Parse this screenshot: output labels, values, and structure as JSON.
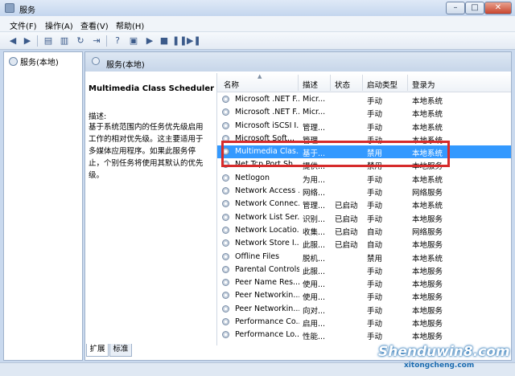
{
  "window": {
    "title": "服务",
    "min": "–",
    "max": "□",
    "close": "✕"
  },
  "menu": [
    "文件(F)",
    "操作(A)",
    "查看(V)",
    "帮助(H)"
  ],
  "tree": {
    "root": "服务(本地)"
  },
  "panel": {
    "header": "服务(本地)",
    "desc_title": "Multimedia Class Scheduler",
    "desc_label": "描述:",
    "desc_text": "基于系统范围内的任务优先级启用工作的相对优先级。这主要适用于多媒体应用程序。如果此服务停止，个别任务将使用其默认的优先级。"
  },
  "columns": [
    "名称",
    "描述",
    "状态",
    "启动类型",
    "登录为"
  ],
  "rows": [
    [
      "Microsoft .NET F...",
      "Micr...",
      "",
      "手动",
      "本地系统"
    ],
    [
      "Microsoft .NET F...",
      "Micr...",
      "",
      "手动",
      "本地系统"
    ],
    [
      "Microsoft iSCSI I...",
      "管理...",
      "",
      "手动",
      "本地系统"
    ],
    [
      "Microsoft Soft...",
      "管理...",
      "",
      "手动",
      "本地系统"
    ],
    [
      "Multimedia Clas...",
      "基于...",
      "",
      "禁用",
      "本地系统"
    ],
    [
      "Net.Tcp Port Sh...",
      "提供...",
      "",
      "禁用",
      "本地服务"
    ],
    [
      "Netlogon",
      "为用...",
      "",
      "手动",
      "本地系统"
    ],
    [
      "Network Access ...",
      "网络...",
      "",
      "手动",
      "网络服务"
    ],
    [
      "Network Connec...",
      "管理...",
      "已启动",
      "手动",
      "本地系统"
    ],
    [
      "Network List Ser...",
      "识别...",
      "已启动",
      "手动",
      "本地服务"
    ],
    [
      "Network Locatio...",
      "收集...",
      "已启动",
      "自动",
      "网络服务"
    ],
    [
      "Network Store I...",
      "此服...",
      "已启动",
      "自动",
      "本地服务"
    ],
    [
      "Offline Files",
      "脱机...",
      "",
      "禁用",
      "本地系统"
    ],
    [
      "Parental Controls",
      "此服...",
      "",
      "手动",
      "本地服务"
    ],
    [
      "Peer Name Res...",
      "使用...",
      "",
      "手动",
      "本地服务"
    ],
    [
      "Peer Networkin...",
      "使用...",
      "",
      "手动",
      "本地服务"
    ],
    [
      "Peer Networkin...",
      "向对...",
      "",
      "手动",
      "本地服务"
    ],
    [
      "Performance Co...",
      "启用...",
      "",
      "手动",
      "本地服务"
    ],
    [
      "Performance Lo...",
      "性能...",
      "",
      "手动",
      "本地服务"
    ]
  ],
  "selected_row": 4,
  "tabs": [
    "扩展",
    "标准"
  ],
  "watermark": {
    "main": "Shenduwin8.com",
    "sub": "xitongcheng.com"
  },
  "colors": {
    "selection": "#3399ff",
    "highlight": "#d62b2b"
  }
}
